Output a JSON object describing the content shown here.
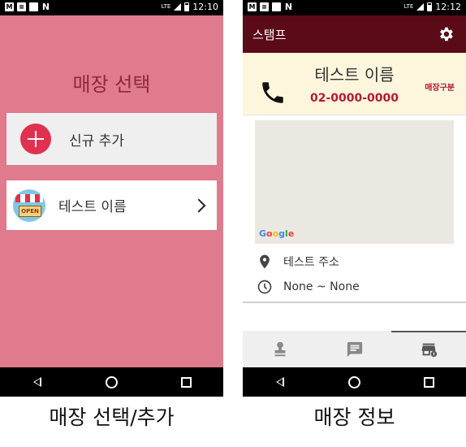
{
  "left_screen": {
    "statusbar": {
      "time": "12:10",
      "network": "LTE"
    },
    "title": "매장 선택",
    "add_button_label": "신규 추가",
    "store_item": {
      "name": "테스트 이름",
      "icon_text": "OPEN"
    }
  },
  "right_screen": {
    "statusbar": {
      "time": "12:12",
      "network": "LTE"
    },
    "app_bar_title": "스탬프",
    "store": {
      "name": "테스트 이름",
      "phone": "02-0000-0000",
      "type": "매장구분",
      "address": "테스트 주소",
      "hours": "None ~ None"
    },
    "map_logo": [
      "G",
      "o",
      "o",
      "g",
      "l",
      "e"
    ],
    "tabs": [
      "stamp-tab",
      "message-tab",
      "store-tab"
    ],
    "active_tab": "store-tab"
  },
  "captions": {
    "left": "매장 선택/추가",
    "right": "매장 정보"
  },
  "colors": {
    "left_background": "#e07a8d",
    "accent_red": "#e0314f",
    "app_bar": "#5b0a18",
    "info_panel": "#fdf6dc",
    "phone_text": "#b01c35"
  }
}
